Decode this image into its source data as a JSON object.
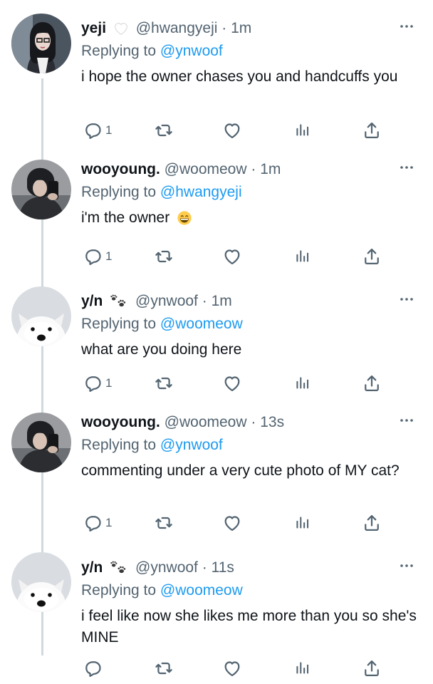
{
  "tweets": [
    {
      "name": "yeji",
      "name_emoji": "white-heart-icon",
      "handle": "@hwangyeji",
      "dot": "·",
      "time": "1m",
      "replying_prefix": "Replying to",
      "replying_to": "@ynwoof",
      "text": "i hope the owner chases you and handcuffs you",
      "reply_count": "1"
    },
    {
      "name": "wooyoung.",
      "name_emoji": "",
      "handle": "@woomeow",
      "dot": "·",
      "time": "1m",
      "replying_prefix": "Replying to",
      "replying_to": "@hwangyeji",
      "text": "i'm the owner",
      "text_emoji": "grinning-face-icon",
      "reply_count": "1"
    },
    {
      "name": "y/n",
      "name_emoji": "paw-prints-icon",
      "handle": "@ynwoof",
      "dot": "·",
      "time": "1m",
      "replying_prefix": "Replying to",
      "replying_to": "@woomeow",
      "text": "what are you doing here",
      "reply_count": "1"
    },
    {
      "name": "wooyoung.",
      "name_emoji": "",
      "handle": "@woomeow",
      "dot": "·",
      "time": "13s",
      "replying_prefix": "Replying to",
      "replying_to": "@ynwoof",
      "text": "commenting under a very cute photo of MY cat?",
      "reply_count": "1"
    },
    {
      "name": "y/n",
      "name_emoji": "paw-prints-icon",
      "handle": "@ynwoof",
      "dot": "·",
      "time": "11s",
      "replying_prefix": "Replying to",
      "replying_to": "@woomeow",
      "text": "i feel like now she likes me more than you so she's MINE",
      "reply_count": ""
    }
  ],
  "colors": {
    "link": "#1d9bf0",
    "secondary": "#536471",
    "thread_line": "#cfd9de"
  }
}
